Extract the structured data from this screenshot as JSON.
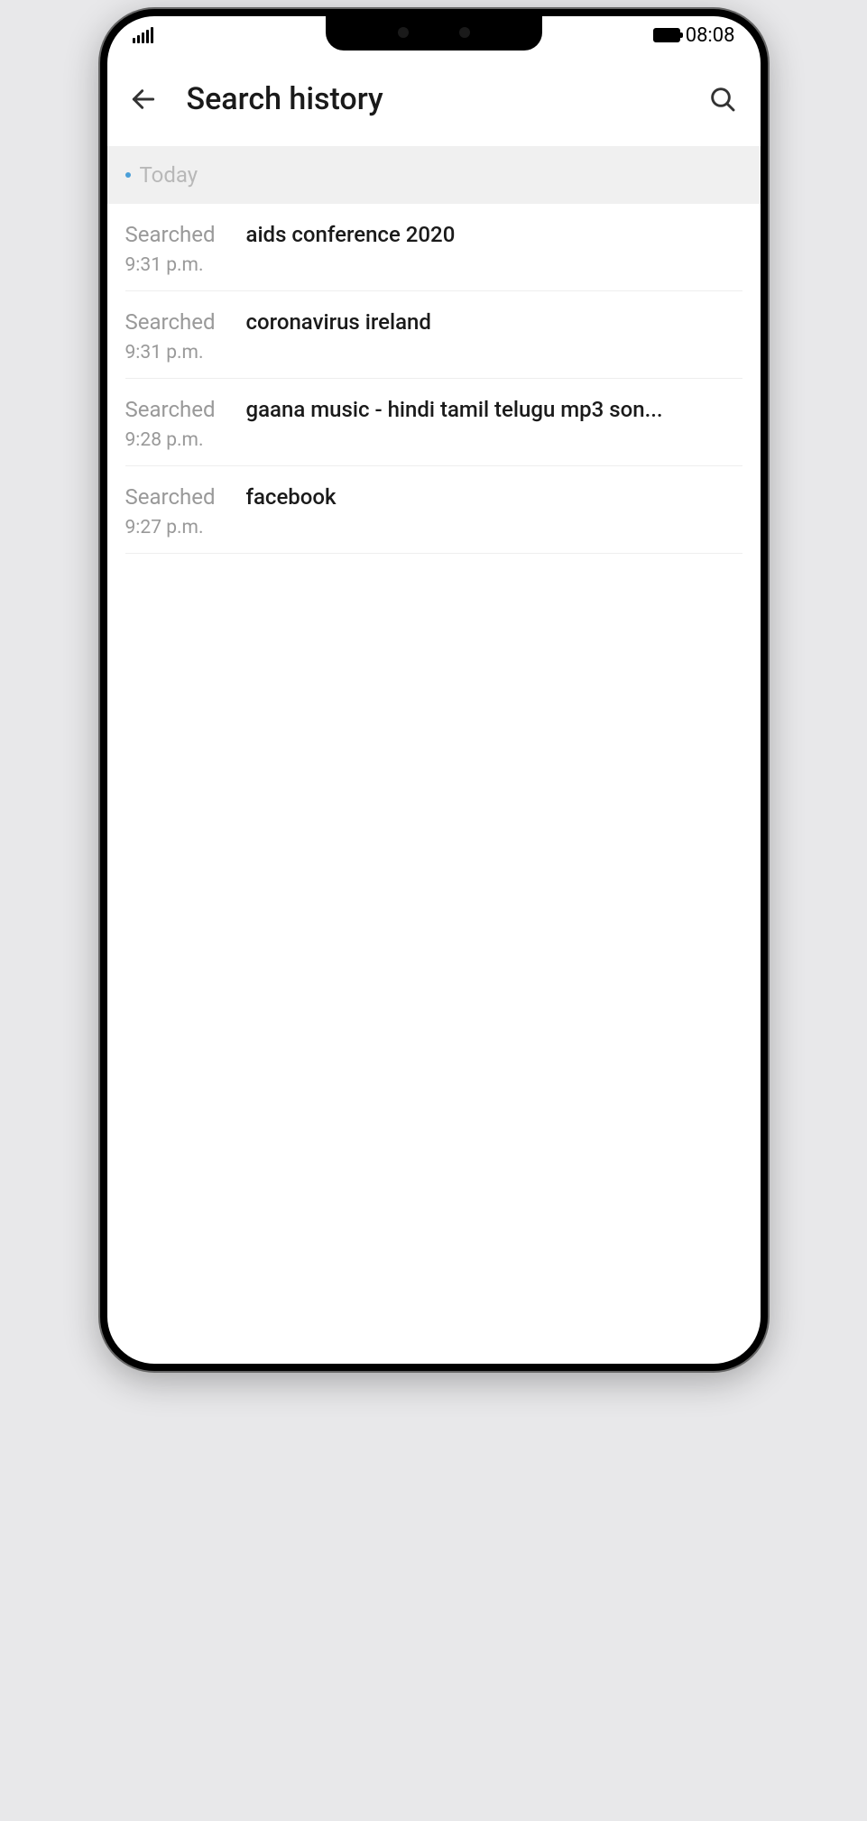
{
  "status_bar": {
    "clock": "08:08"
  },
  "header": {
    "title": "Search history"
  },
  "section": {
    "label": "Today"
  },
  "history": {
    "searched_label": "Searched",
    "items": [
      {
        "query": "aids conference 2020",
        "time": "9:31 p.m."
      },
      {
        "query": "coronavirus ireland",
        "time": "9:31 p.m."
      },
      {
        "query": "gaana music - hindi tamil telugu mp3 son...",
        "time": "9:28 p.m."
      },
      {
        "query": "facebook",
        "time": "9:27 p.m."
      }
    ]
  }
}
